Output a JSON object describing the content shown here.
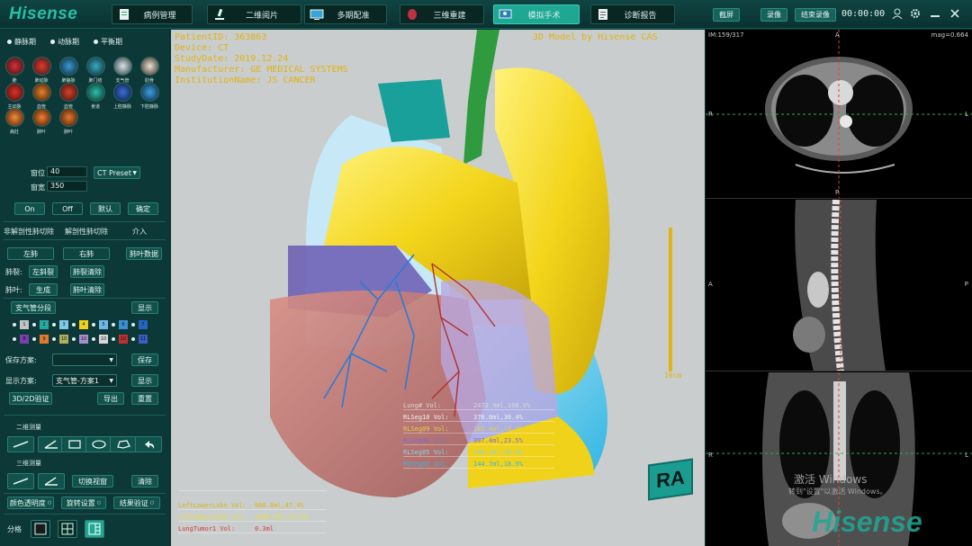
{
  "app": {
    "logo": "Hisense",
    "nav": [
      {
        "label": "病例管理",
        "icon": "case-icon"
      },
      {
        "label": "二维阅片",
        "icon": "microscope-icon"
      },
      {
        "label": "多期配准",
        "icon": "monitor-icon"
      },
      {
        "label": "三维重建",
        "icon": "reconstruct-icon"
      },
      {
        "label": "模拟手术",
        "icon": "surgery-icon"
      },
      {
        "label": "诊断报告",
        "icon": "report-icon"
      }
    ],
    "active_nav": "模拟手术",
    "record": {
      "screenshot": "截屏",
      "record": "录像",
      "stop": "结束录像",
      "timer": "00:00:00"
    }
  },
  "left": {
    "phases": [
      "静脉期",
      "动脉期",
      "平衡期"
    ],
    "vessels_row1": [
      "肺",
      "肺动脉",
      "肺静脉",
      "肺门结",
      "支气管",
      "肋骨"
    ],
    "vessels_row2": [
      "主动脉",
      "血管",
      "血管",
      "食道",
      "上腔静脉",
      "下腔静脉"
    ],
    "vessels_row3": [
      "病灶",
      "肺叶",
      "肺叶"
    ],
    "window": {
      "level_label": "窗位",
      "level": "40",
      "width_label": "窗宽",
      "width": "350",
      "preset": "CT Preset"
    },
    "wl_buttons": [
      "On",
      "Off",
      "默认",
      "确定"
    ],
    "tabs": [
      "非解剖性肺切除",
      "解剖性肺切除",
      "介入"
    ],
    "lung_tabs": [
      "左肺",
      "右肺",
      "肺叶数据"
    ],
    "fissure_label": "肺裂:",
    "fissure_btns": [
      "左斜裂",
      "肺裂清除"
    ],
    "lobe_label": "肺叶:",
    "lobe_btns": [
      "生成",
      "肺叶清除"
    ],
    "bronchus_btn": "支气管分段",
    "show_btn": "显示",
    "seg_row1": [
      "1",
      "2",
      "3",
      "4",
      "5",
      "6",
      "7"
    ],
    "seg_row2": [
      "8",
      "9",
      "10",
      "10",
      "10",
      "10",
      "11"
    ],
    "save_label": "保存方案:",
    "save_btn": "保存",
    "display_label": "显示方案:",
    "display_value": "支气管-方案1",
    "display_btn": "显示",
    "verify_btn": "3D/2D验证",
    "export_btn": "导出",
    "reset_btn": "重置",
    "measure2d_title": "二维测量",
    "measure3d_title": "三维测量",
    "switch_view_btn": "切换视窗",
    "clear_btn": "清除",
    "bottom_btns": [
      "颜色透明度",
      "旋转设置",
      "结果验证"
    ],
    "split_label": "分格"
  },
  "viewport": {
    "patient_lines": [
      "PatientID: 363863",
      "Device: CT",
      "StudyDate: 2019.12.24",
      "Manufacturer: GE MEDICAL SYSTEMS",
      "InstitutionName: JS CANCER"
    ],
    "model_label": "3D Model by Hisense CAS",
    "scale": "10cm",
    "orient": "RA",
    "vol_left": [
      {
        "name": "",
        "value": ""
      },
      {
        "name": "LeftLowerLobe Vol:",
        "value": "968.8ml,47.4%"
      },
      {
        "name": "LeftUpperLobe Vol:",
        "value": "1098.9ml,52.6%"
      },
      {
        "name": "LungTumor1 Vol:",
        "value": "0.3ml"
      }
    ],
    "vol_right": [
      {
        "name": "Lung# Vol:",
        "value": "2473.9ml,100.0%"
      },
      {
        "name": "RLSeg10 Vol:",
        "value": "376.0ml,30.4%"
      },
      {
        "name": "RLSeg09 Vol:",
        "value": "182.4ml,14.7%"
      },
      {
        "name": "RLSeg06 Vol:",
        "value": "307.4ml,23.5%"
      },
      {
        "name": "RLSeg05 Vol:",
        "value": "148.1ml,36.4%"
      },
      {
        "name": "RUSeg03 Vol:",
        "value": "144.7ml,18.9%"
      }
    ]
  },
  "ct": {
    "axial": {
      "index": "IM:159/317",
      "mag": "mag=0.664",
      "top": "A",
      "bottom": "P",
      "left": "R",
      "right": "L"
    },
    "sagittal": {
      "left": "A",
      "right": "P"
    },
    "coronal": {
      "left": "R",
      "right": "L"
    },
    "watermark1": "激活 Windows",
    "watermark2": "转到\"设置\"以激活 Windows。",
    "brand": "Hisense"
  },
  "colors": {
    "accent": "#1ea894",
    "overlay": "#e1b314",
    "lung_yellow": "#f0d21a"
  }
}
